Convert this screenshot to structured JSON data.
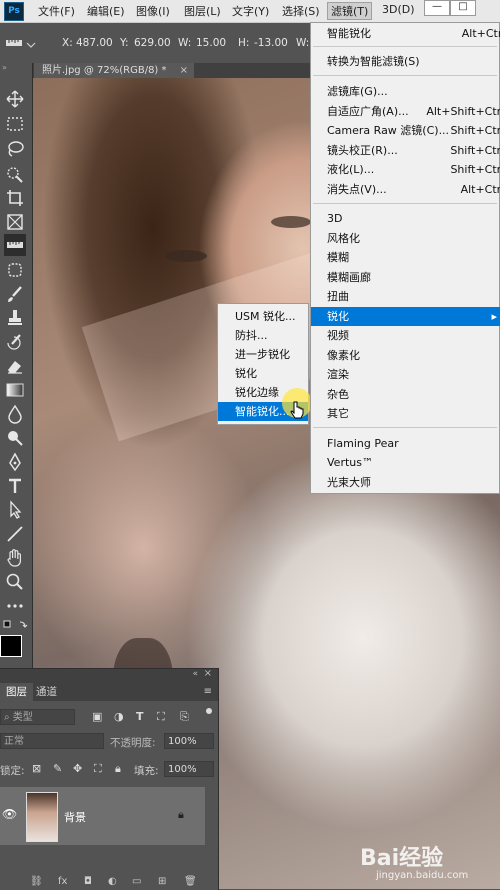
{
  "menubar": {
    "logo": "Ps",
    "items": [
      "文件(F)",
      "编辑(E)",
      "图像(I)",
      "图层(L)",
      "文字(Y)",
      "选择(S)",
      "滤镜(T)",
      "3D(D)"
    ],
    "window_buttons": [
      "—",
      "□"
    ]
  },
  "options_bar": {
    "x_label": "X:",
    "x_value": "487.00",
    "y_label": "Y:",
    "y_value": "629.00",
    "w_label": "W:",
    "w_value": "15.00",
    "h_label": "H:",
    "h_value": "-13.00",
    "w_short": "W:"
  },
  "document_tab": {
    "title": "照片.jpg @ 72%(RGB/8) *",
    "close": "×"
  },
  "layers_panel": {
    "tabs": [
      "图层",
      "通道"
    ],
    "kind_filter": "类型",
    "blend_mode": "正常",
    "opacity_label": "不透明度:",
    "opacity_value": "100%",
    "lock_label": "锁定:",
    "fill_label": "填充:",
    "fill_value": "100%",
    "layer_name": "背景"
  },
  "filter_menu": {
    "items": [
      {
        "label": "智能锐化",
        "shortcut": "Alt+Ctrl+F"
      },
      {
        "label": "转换为智能滤镜(S)",
        "shortcut": ""
      },
      {
        "label": "滤镜库(G)...",
        "shortcut": ""
      },
      {
        "label": "自适应广角(A)...",
        "shortcut": "Alt+Shift+Ctrl+A"
      },
      {
        "label": "Camera Raw 滤镜(C)...",
        "shortcut": "Shift+Ctrl+A"
      },
      {
        "label": "镜头校正(R)...",
        "shortcut": "Shift+Ctrl+R"
      },
      {
        "label": "液化(L)...",
        "shortcut": "Shift+Ctrl+X"
      },
      {
        "label": "消失点(V)...",
        "shortcut": "Alt+Ctrl+V"
      },
      {
        "label": "3D",
        "shortcut": ""
      },
      {
        "label": "风格化",
        "shortcut": ""
      },
      {
        "label": "模糊",
        "shortcut": ""
      },
      {
        "label": "模糊画廊",
        "shortcut": ""
      },
      {
        "label": "扭曲",
        "shortcut": ""
      },
      {
        "label": "锐化",
        "shortcut": ""
      },
      {
        "label": "视频",
        "shortcut": ""
      },
      {
        "label": "像素化",
        "shortcut": ""
      },
      {
        "label": "渲染",
        "shortcut": ""
      },
      {
        "label": "杂色",
        "shortcut": ""
      },
      {
        "label": "其它",
        "shortcut": ""
      },
      {
        "label": "Flaming Pear",
        "shortcut": ""
      },
      {
        "label": "Vertus™",
        "shortcut": ""
      },
      {
        "label": "光束大师",
        "shortcut": ""
      }
    ]
  },
  "sharpen_submenu": {
    "items": [
      "USM 锐化...",
      "防抖...",
      "进一步锐化",
      "锐化",
      "锐化边缘",
      "智能锐化..."
    ]
  },
  "watermark": {
    "brand": "Bai经验",
    "url": "jingyan.baidu.com"
  },
  "colors": {
    "accent": "#0078d7",
    "menu_bg": "#f0f0f0",
    "ui_dark": "#535353"
  }
}
